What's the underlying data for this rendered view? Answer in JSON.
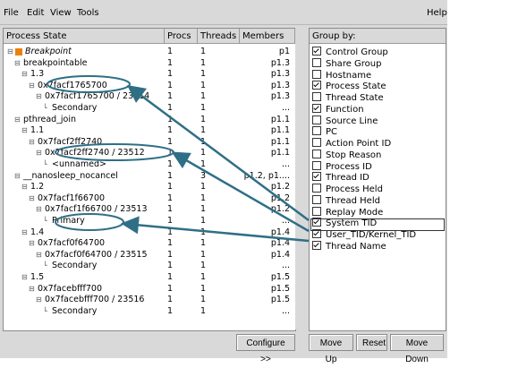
{
  "menu": {
    "file": "File",
    "edit": "Edit",
    "view": "View",
    "tools": "Tools",
    "help": "Help"
  },
  "left_panel": {
    "headers": [
      "Process State",
      "Procs",
      "Threads",
      "Members"
    ],
    "rows": [
      {
        "label": "Breakpoint",
        "procs": "1",
        "threads": "1",
        "members": "p1",
        "italic": true
      },
      {
        "label": "breakpointable",
        "procs": "1",
        "threads": "1",
        "members": "p1.3"
      },
      {
        "label": "1.3",
        "procs": "1",
        "threads": "1",
        "members": "p1.3"
      },
      {
        "label": "0x7facf1765700",
        "procs": "1",
        "threads": "1",
        "members": "p1.3"
      },
      {
        "label": "0x7facf1765700 / 23514",
        "procs": "1",
        "threads": "1",
        "members": "p1.3"
      },
      {
        "label": "Secondary",
        "procs": "1",
        "threads": "1",
        "members": "..."
      },
      {
        "label": "pthread_join",
        "procs": "1",
        "threads": "1",
        "members": "p1.1"
      },
      {
        "label": "1.1",
        "procs": "1",
        "threads": "1",
        "members": "p1.1"
      },
      {
        "label": "0x7facf2ff2740",
        "procs": "1",
        "threads": "1",
        "members": "p1.1"
      },
      {
        "label": "0x7facf2ff2740 / 23512",
        "procs": "1",
        "threads": "1",
        "members": "p1.1"
      },
      {
        "label": "<unnamed>",
        "procs": "1",
        "threads": "1",
        "members": "..."
      },
      {
        "label": "__nanosleep_nocancel",
        "procs": "1",
        "threads": "3",
        "members": "p1.2, p1...."
      },
      {
        "label": "1.2",
        "procs": "1",
        "threads": "1",
        "members": "p1.2"
      },
      {
        "label": "0x7facf1f66700",
        "procs": "1",
        "threads": "1",
        "members": "p1.2"
      },
      {
        "label": "0x7facf1f66700 / 23513",
        "procs": "1",
        "threads": "1",
        "members": "p1.2"
      },
      {
        "label": "Primary",
        "procs": "1",
        "threads": "1",
        "members": "..."
      },
      {
        "label": "1.4",
        "procs": "1",
        "threads": "1",
        "members": "p1.4"
      },
      {
        "label": "0x7facf0f64700",
        "procs": "1",
        "threads": "1",
        "members": "p1.4"
      },
      {
        "label": "0x7facf0f64700 / 23515",
        "procs": "1",
        "threads": "1",
        "members": "p1.4"
      },
      {
        "label": "Secondary",
        "procs": "1",
        "threads": "1",
        "members": "..."
      },
      {
        "label": "1.5",
        "procs": "1",
        "threads": "1",
        "members": "p1.5"
      },
      {
        "label": "0x7facebfff700",
        "procs": "1",
        "threads": "1",
        "members": "p1.5"
      },
      {
        "label": "0x7facebfff700 / 23516",
        "procs": "1",
        "threads": "1",
        "members": "p1.5"
      },
      {
        "label": "Secondary",
        "procs": "1",
        "threads": "1",
        "members": "..."
      }
    ],
    "configure_button": "Configure >>"
  },
  "group_by": {
    "header": "Group by:",
    "items": [
      {
        "label": "Control Group",
        "checked": true
      },
      {
        "label": "Share Group",
        "checked": false
      },
      {
        "label": "Hostname",
        "checked": false
      },
      {
        "label": "Process State",
        "checked": true
      },
      {
        "label": "Thread State",
        "checked": false
      },
      {
        "label": "Function",
        "checked": true
      },
      {
        "label": "Source Line",
        "checked": false
      },
      {
        "label": "PC",
        "checked": false
      },
      {
        "label": "Action Point ID",
        "checked": false
      },
      {
        "label": "Stop Reason",
        "checked": false
      },
      {
        "label": "Process ID",
        "checked": false
      },
      {
        "label": "Thread ID",
        "checked": true
      },
      {
        "label": "Process Held",
        "checked": false
      },
      {
        "label": "Thread Held",
        "checked": false
      },
      {
        "label": "Replay Mode",
        "checked": false
      },
      {
        "label": "System TID",
        "checked": true
      },
      {
        "label": "User_TID/Kernel_TID",
        "checked": true
      },
      {
        "label": "Thread Name",
        "checked": true
      }
    ],
    "buttons": {
      "move_up": "Move Up",
      "reset": "Reset",
      "move_down": "Move Down"
    }
  },
  "colors": {
    "annotation": "#2f6f86",
    "window_bg": "#d9d9d9",
    "breakpoint_icon": "#e8820c"
  }
}
